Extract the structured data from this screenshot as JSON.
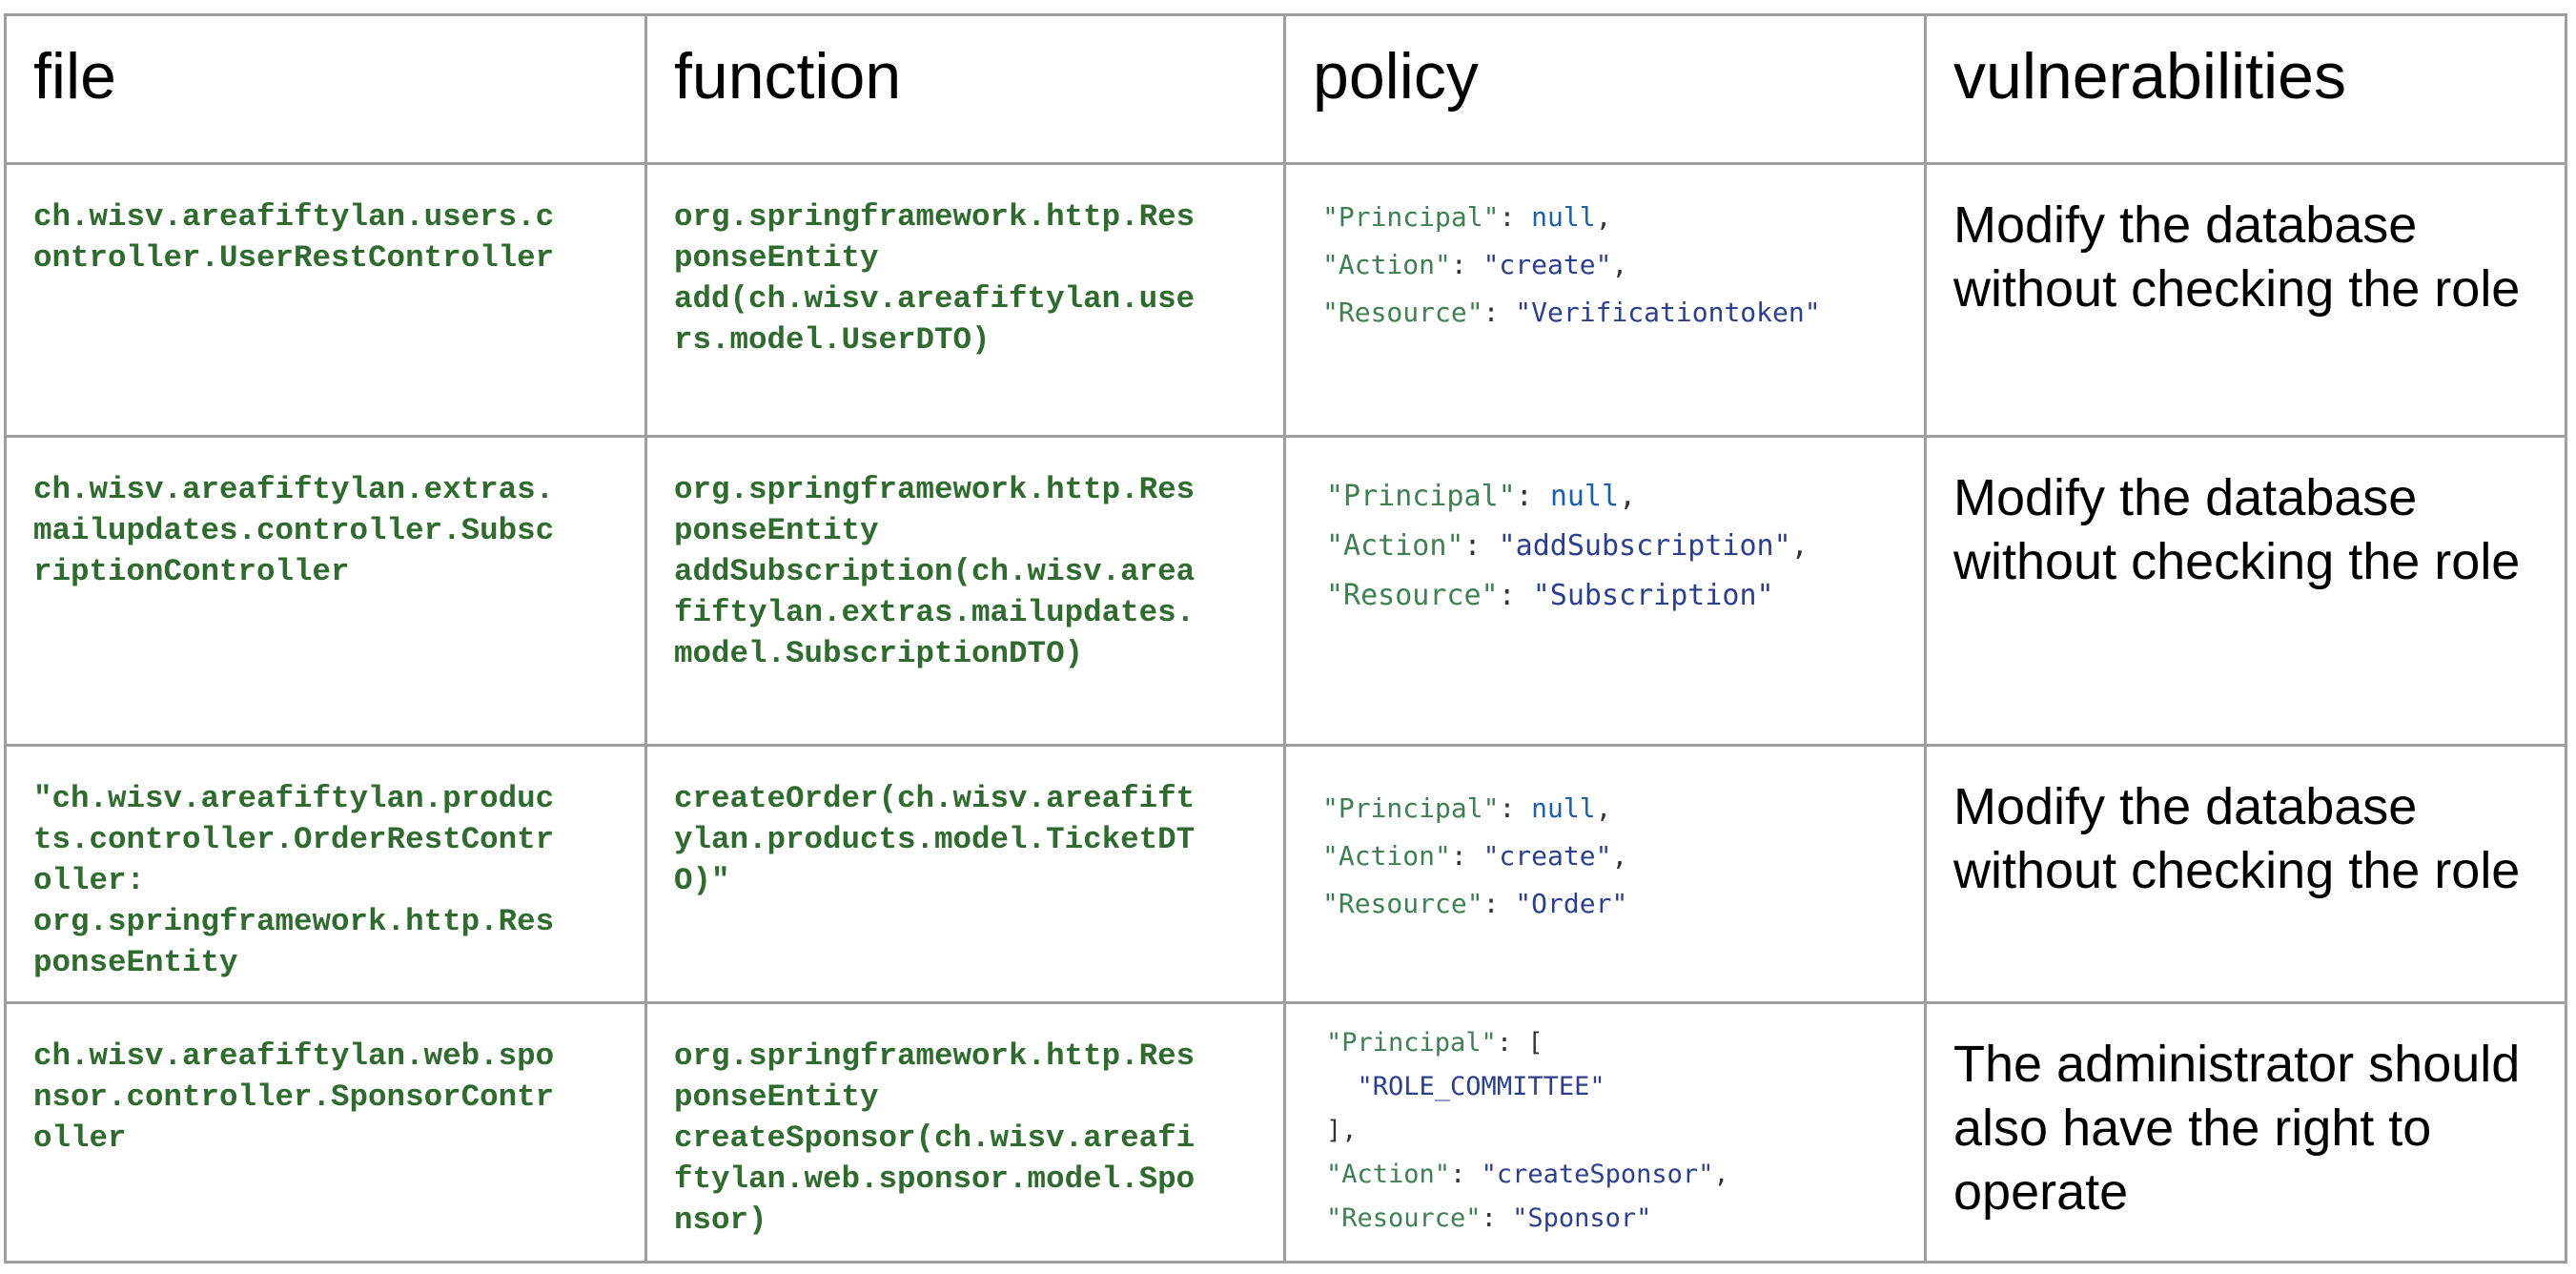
{
  "headers": {
    "file": "file",
    "function": "function",
    "policy": "policy",
    "vulnerabilities": "vulnerabilities"
  },
  "rows": [
    {
      "file": "ch.wisv.areafiftylan.users.c\nontroller.UserRestController",
      "function": "org.springframework.http.Res\nponseEntity\nadd(ch.wisv.areafiftylan.use\nrs.model.UserDTO)",
      "policy": {
        "principal_key": "\"Principal\"",
        "principal_value": "null",
        "action_key": "\"Action\"",
        "action_value": "\"create\"",
        "resource_key": "\"Resource\"",
        "resource_value": "\"Verificationtoken\""
      },
      "vulnerability": "Modify the database without checking the role"
    },
    {
      "file": "ch.wisv.areafiftylan.extras.\nmailupdates.controller.Subsc\nriptionController",
      "function": "org.springframework.http.Res\nponseEntity\naddSubscription(ch.wisv.area\nfiftylan.extras.mailupdates.\nmodel.SubscriptionDTO)",
      "policy": {
        "principal_key": "\"Principal\"",
        "principal_value": "null",
        "action_key": "\"Action\"",
        "action_value": "\"addSubscription\"",
        "resource_key": "\"Resource\"",
        "resource_value": "\"Subscription\""
      },
      "vulnerability": "Modify the database without checking the role"
    },
    {
      "file": "\"ch.wisv.areafiftylan.produc\nts.controller.OrderRestContr\noller:\norg.springframework.http.Res\nponseEntity",
      "function": "createOrder(ch.wisv.areafift\nylan.products.model.TicketDT\nO)\"",
      "policy": {
        "principal_key": "\"Principal\"",
        "principal_value": "null",
        "action_key": "\"Action\"",
        "action_value": "\"create\"",
        "resource_key": "\"Resource\"",
        "resource_value": "\"Order\""
      },
      "vulnerability": "Modify the database without checking the role"
    },
    {
      "file": "ch.wisv.areafiftylan.web.spo\nnsor.controller.SponsorContr\noller",
      "function": "org.springframework.http.Res\nponseEntity\ncreateSponsor(ch.wisv.areafi\nftylan.web.sponsor.model.Spo\nnsor)",
      "policy": {
        "principal_key": "\"Principal\"",
        "principal_open": "[",
        "principal_role": "\"ROLE_COMMITTEE\"",
        "principal_close": "],",
        "action_key": "\"Action\"",
        "action_value": "\"createSponsor\"",
        "resource_key": "\"Resource\"",
        "resource_value": "\"Sponsor\""
      },
      "vulnerability": "The administrator should also have the right to operate"
    }
  ]
}
